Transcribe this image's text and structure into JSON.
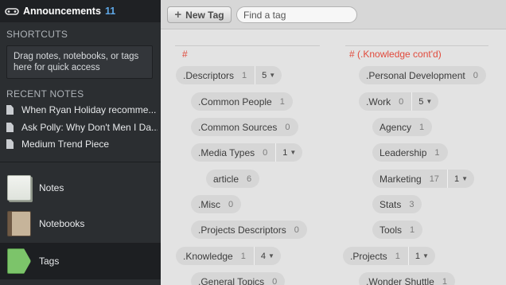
{
  "sidebar": {
    "account_label": "Announcements",
    "account_count": "11",
    "shortcuts_heading": "SHORTCUTS",
    "shortcuts_hint": "Drag notes, notebooks, or tags here for quick access",
    "recent_heading": "RECENT NOTES",
    "recent_notes": [
      "When Ryan Holiday recomme...",
      "Ask Polly: Why Don't Men I Da...",
      "Medium Trend Piece"
    ],
    "nav": [
      {
        "label": "Notes",
        "icon": "notes-icon"
      },
      {
        "label": "Notebooks",
        "icon": "notebooks-icon"
      },
      {
        "label": "Tags",
        "icon": "tags-icon"
      }
    ]
  },
  "toolbar": {
    "new_tag_label": "New Tag",
    "find_placeholder": "Find a tag"
  },
  "columns": [
    {
      "heading": "#",
      "tags": [
        {
          "name": ".Descriptors",
          "count": "1",
          "children": "5"
        },
        {
          "name": ".Common People",
          "count": "1"
        },
        {
          "name": ".Common Sources",
          "count": "0"
        },
        {
          "name": ".Media Types",
          "count": "0",
          "children": "1"
        },
        {
          "name": "article",
          "count": "6"
        },
        {
          "name": ".Misc",
          "count": "0"
        },
        {
          "name": ".Projects Descriptors",
          "count": "0"
        },
        {
          "name": ".Knowledge",
          "count": "1",
          "children": "4"
        },
        {
          "name": ".General Topics",
          "count": "0"
        }
      ]
    },
    {
      "heading": "# (.Knowledge cont'd)",
      "tags": [
        {
          "name": ".Personal Development",
          "count": "0"
        },
        {
          "name": ".Work",
          "count": "0",
          "children": "5"
        },
        {
          "name": "Agency",
          "count": "1"
        },
        {
          "name": "Leadership",
          "count": "1"
        },
        {
          "name": "Marketing",
          "count": "17",
          "children": "1"
        },
        {
          "name": "Stats",
          "count": "3"
        },
        {
          "name": "Tools",
          "count": "1"
        },
        {
          "name": ".Projects",
          "count": "1",
          "children": "1"
        },
        {
          "name": ".Wonder Shuttle",
          "count": "1"
        }
      ]
    }
  ]
}
